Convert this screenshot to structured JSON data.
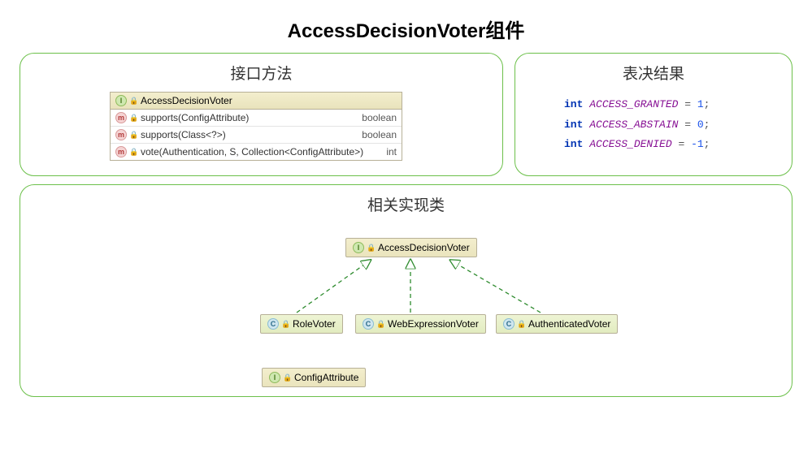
{
  "title": "AccessDecisionVoter组件",
  "panels": {
    "interface": {
      "title": "接口方法",
      "header": "AccessDecisionVoter",
      "methods": [
        {
          "name": "supports(ConfigAttribute)",
          "ret": "boolean"
        },
        {
          "name": "supports(Class<?>)",
          "ret": "boolean"
        },
        {
          "name": "vote(Authentication, S, Collection<ConfigAttribute>)",
          "ret": "int"
        }
      ]
    },
    "results": {
      "title": "表决结果",
      "constants": [
        {
          "kw": "int",
          "name": "ACCESS_GRANTED",
          "val": "1"
        },
        {
          "kw": "int",
          "name": "ACCESS_ABSTAIN",
          "val": "0"
        },
        {
          "kw": "int",
          "name": "ACCESS_DENIED",
          "val": "-1"
        }
      ]
    },
    "impl": {
      "title": "相关实现类",
      "parent": "AccessDecisionVoter",
      "children": [
        "RoleVoter",
        "WebExpressionVoter",
        "AuthenticatedVoter"
      ],
      "extra": "ConfigAttribute"
    }
  }
}
